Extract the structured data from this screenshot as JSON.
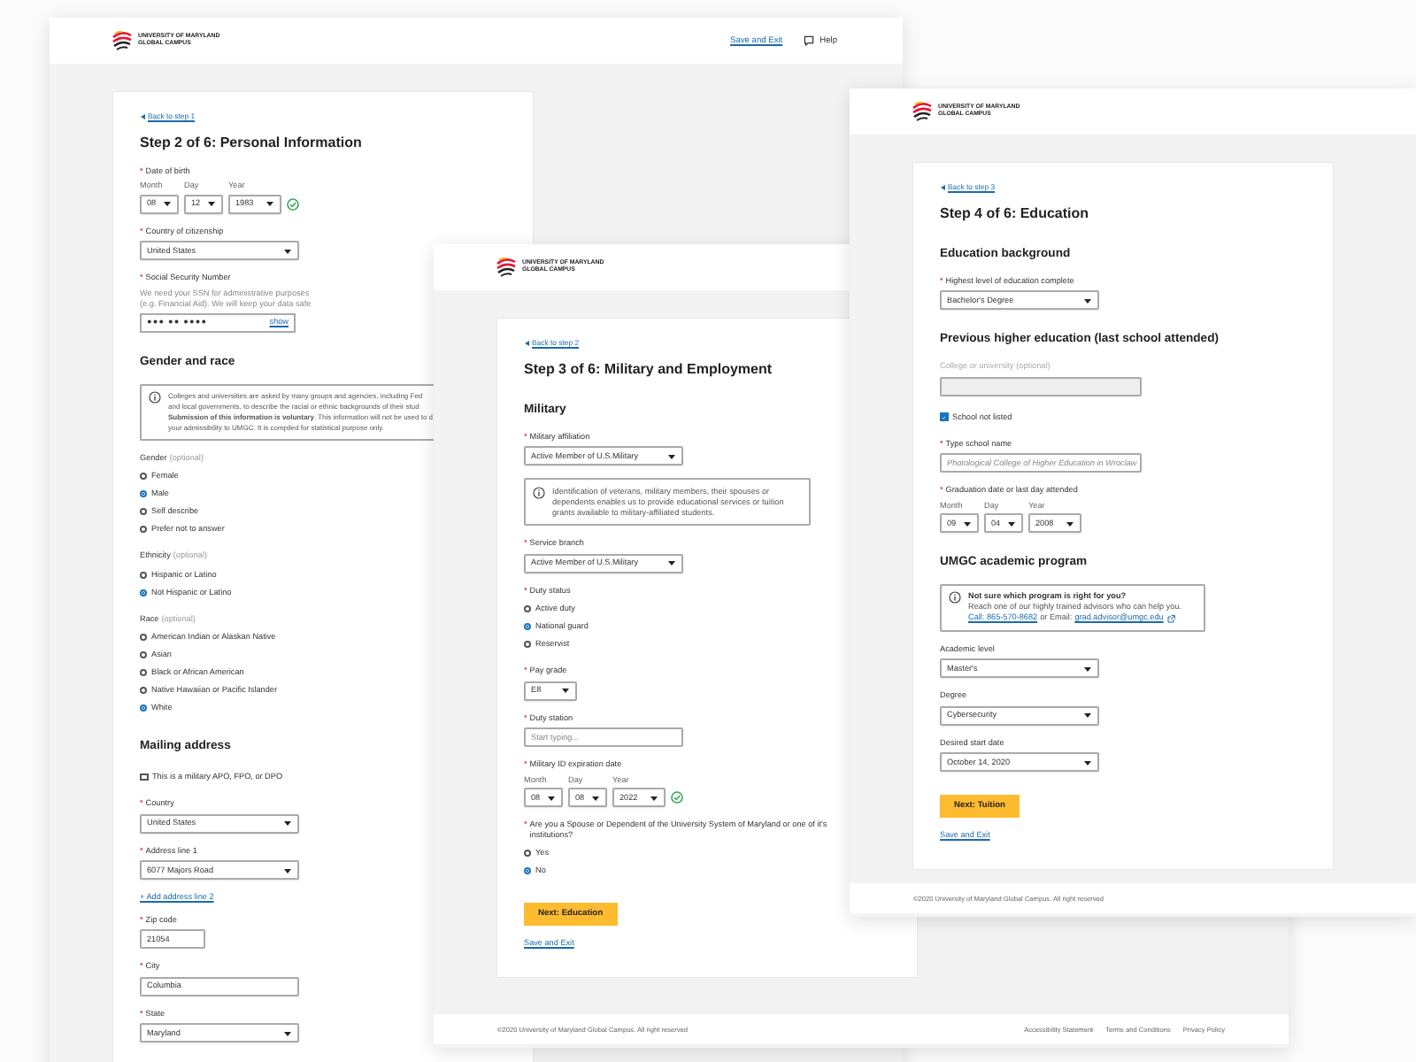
{
  "windows": [
    {
      "logo": [
        "UNIVERSITY OF MARYLAND",
        "GLOBAL CAMPUS"
      ],
      "header_links": [
        {
          "kind": "link",
          "text": "Save and Exit"
        },
        {
          "kind": "help",
          "text": "Help"
        }
      ],
      "card": {
        "back": "Back to step 1",
        "title": "Step 2 of 6: Personal Information",
        "items": [
          {
            "kind": "date",
            "marker": "*",
            "label": "Date of birth",
            "parts": [
              {
                "label": "Month",
                "value": "08"
              },
              {
                "label": "Day",
                "value": "12"
              },
              {
                "label": "Year",
                "value": "1983"
              }
            ],
            "valid": true
          },
          {
            "kind": "select",
            "marker": "*",
            "label": "Country of citizenship",
            "value": "United States"
          },
          {
            "kind": "secret",
            "marker": "*",
            "label": "Social Security Number",
            "hint_lines": [
              "We need your SSN for administrative purposes",
              "(e.g. Financial Aid). We will keep your data safe"
            ],
            "value": "●●● ●● ●●●●",
            "action": "show"
          },
          {
            "kind": "heading",
            "text": "Gender and race"
          },
          {
            "kind": "info",
            "lines": [
              "Colleges and universities are asked by many groups and agencies, including Fed",
              "and local governments, to describe the racial or ethnic backgrounds of their stud",
              "**Submission of this information is voluntary**. This information will not be used to d",
              "your admissibility to UMGC. It is compiled for statistical purpose only."
            ]
          },
          {
            "kind": "radios",
            "label": "Gender",
            "hint": "(optional)",
            "options": [
              {
                "label": "Female",
                "selected": false
              },
              {
                "label": "Male",
                "selected": true
              },
              {
                "label": "Self describe",
                "selected": false
              },
              {
                "label": "Prefer not to answer",
                "selected": false
              }
            ]
          },
          {
            "kind": "radios",
            "label": "Ethnicity",
            "hint": "(optional)",
            "options": [
              {
                "label": "Hispanic or Latino",
                "selected": false
              },
              {
                "label": "Not Hispanic or Latino",
                "selected": true
              }
            ]
          },
          {
            "kind": "radios",
            "label": "Race",
            "hint": "(optional)",
            "options": [
              {
                "label": "American Indian or Alaskan Native",
                "selected": false
              },
              {
                "label": "Asian",
                "selected": false
              },
              {
                "label": "Black or African American",
                "selected": false
              },
              {
                "label": "Native Hawaiian or Pacific Islander",
                "selected": false
              },
              {
                "label": "White",
                "selected": true
              }
            ]
          },
          {
            "kind": "heading",
            "text": "Mailing address"
          },
          {
            "kind": "checkbox",
            "label": "This is a military APO, FPO, or DPO",
            "checked": false
          },
          {
            "kind": "select",
            "marker": "*",
            "label": "Country",
            "value": "United States"
          },
          {
            "kind": "select",
            "marker": "*",
            "label": "Address line 1",
            "value": "6077 Majors Road"
          },
          {
            "kind": "link",
            "text": "+ Add address line 2"
          },
          {
            "kind": "input",
            "marker": "*",
            "label": "Zip code",
            "value": "21054"
          },
          {
            "kind": "input",
            "marker": "*",
            "label": "City",
            "value": "Columbia"
          },
          {
            "kind": "select",
            "marker": "*",
            "label": "State",
            "value": "Maryland"
          }
        ]
      }
    },
    {
      "logo": [
        "UNIVERSITY OF MARYLAND",
        "GLOBAL CAMPUS"
      ],
      "card": {
        "back": "Back to step 2",
        "title": "Step 3 of 6: Military and Employment",
        "items": [
          {
            "kind": "heading",
            "text": "Military"
          },
          {
            "kind": "select",
            "marker": "*",
            "label": "Military affiliation",
            "value": "Active Member of U.S.Military"
          },
          {
            "kind": "info",
            "text": "Identification of veterans, military members, their spouses or dependents enables us to provide educational services or tuition grants available to military-affiliated students."
          },
          {
            "kind": "select",
            "marker": "*",
            "label": "Service branch",
            "value": "Active Member of U.S.Military"
          },
          {
            "kind": "radios",
            "marker": "*",
            "label": "Duty status",
            "options": [
              {
                "label": "Active duty",
                "selected": false
              },
              {
                "label": "National guard",
                "selected": true
              },
              {
                "label": "Reservist",
                "selected": false
              }
            ]
          },
          {
            "kind": "select",
            "marker": "*",
            "label": "Pay grade",
            "value": "E8"
          },
          {
            "kind": "input",
            "marker": "*",
            "label": "Duty station",
            "placeholder": "Start typing..."
          },
          {
            "kind": "date",
            "marker": "*",
            "label": "Military ID expiration date",
            "parts": [
              {
                "label": "Month",
                "value": "08"
              },
              {
                "label": "Day",
                "value": "08"
              },
              {
                "label": "Year",
                "value": "2022"
              }
            ],
            "valid": true
          },
          {
            "kind": "radios",
            "marker": "*",
            "label": "Are you a Spouse or Dependent of the University System of Maryland or one of it's institutions?",
            "options": [
              {
                "label": "Yes",
                "selected": false
              },
              {
                "label": "No",
                "selected": true
              }
            ]
          },
          {
            "kind": "button",
            "text": "Next: Education"
          },
          {
            "kind": "link",
            "text": "Save and Exit"
          }
        ]
      },
      "footer": {
        "copyright": "©2020 University of Maryland Global Campus. All right reserved",
        "links": [
          "Accessibility Statement",
          "Terms and Conditions",
          "Privacy Policy"
        ]
      }
    },
    {
      "logo": [
        "UNIVERSITY OF MARYLAND",
        "GLOBAL CAMPUS"
      ],
      "card": {
        "back": "Back to step 3",
        "title": "Step 4 of 6: Education",
        "items": [
          {
            "kind": "heading",
            "text": "Education background"
          },
          {
            "kind": "select",
            "marker": "*",
            "label": "Highest level of education complete",
            "value": "Bachelor's Degree"
          },
          {
            "kind": "heading",
            "text": "Previous higher education (last school attended)"
          },
          {
            "kind": "input",
            "label": "College or university",
            "hint": "(optional)",
            "disabled": true
          },
          {
            "kind": "checkbox",
            "label": "School not listed",
            "checked": true
          },
          {
            "kind": "input",
            "marker": "*",
            "label": "Type school name",
            "placeholder": "Photological College of Higher Education in Wroclaw"
          },
          {
            "kind": "date",
            "marker": "*",
            "label": "Graduation date or last day attended",
            "parts": [
              {
                "label": "Month",
                "value": "09"
              },
              {
                "label": "Day",
                "value": "04"
              },
              {
                "label": "Year",
                "value": "2008"
              }
            ],
            "valid": false
          },
          {
            "kind": "heading",
            "text": "UMGC academic program"
          },
          {
            "kind": "info",
            "title": "Not sure which program is right for you?",
            "text": "Reach one of our highly trained advisors who can help you.",
            "line": [
              {
                "text": "Call: 865-570-8682",
                "link": true
              },
              {
                "text": "or Email:",
                "link": false
              },
              {
                "text": "grad.advisor@umgc.edu",
                "link": true,
                "external": true
              }
            ]
          },
          {
            "kind": "select",
            "label": "Academic level",
            "value": "Master's"
          },
          {
            "kind": "select",
            "label": "Degree",
            "value": "Cybersecurity"
          },
          {
            "kind": "select",
            "label": "Desired start date",
            "value": "October 14, 2020"
          },
          {
            "kind": "button",
            "text": "Next: Tuition"
          },
          {
            "kind": "link",
            "text": "Save and Exit"
          }
        ]
      },
      "footer": {
        "copyright": "©2020 University of Maryland Global Campus. All right reserved"
      }
    }
  ]
}
